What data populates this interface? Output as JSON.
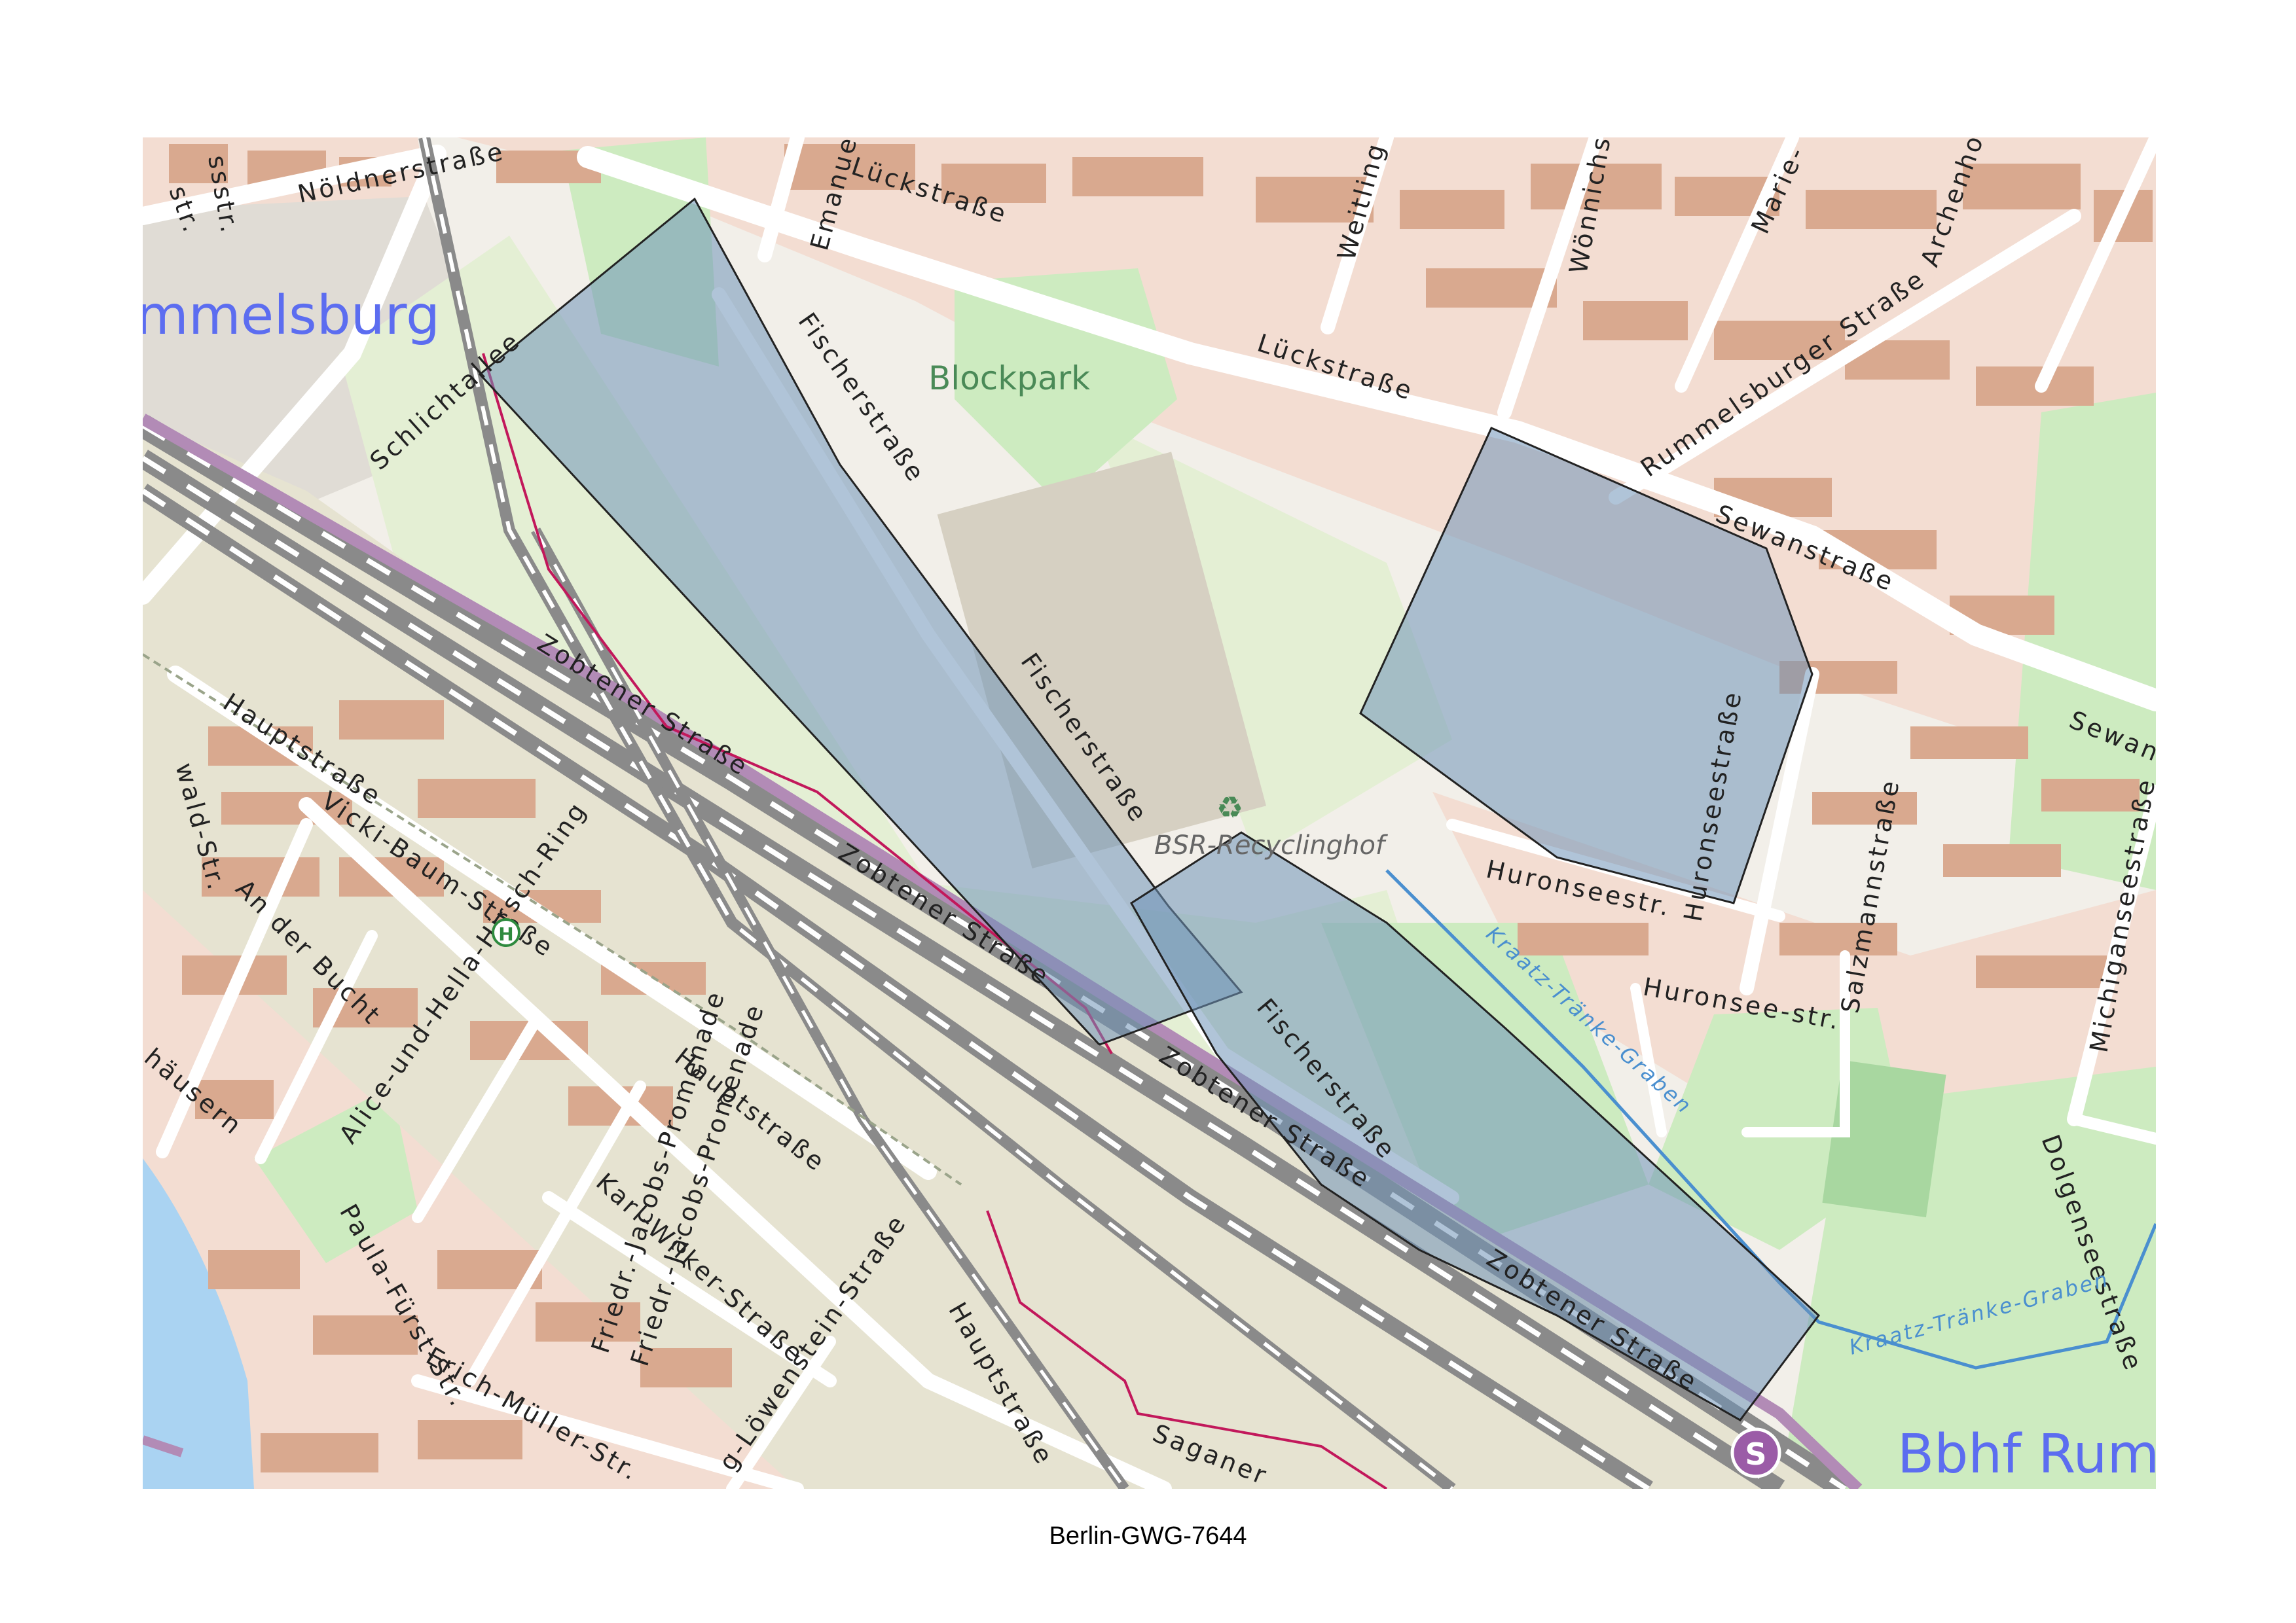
{
  "map": {
    "place_labels": [
      "mmelsburg",
      "Bbhf Rummelsb"
    ],
    "park_label": "Blockpark",
    "poi_label": "BSR-Recyclinghof",
    "water_labels": [
      "Kraatz-Tränke-Graben",
      "Kraatz-Tränke-Graben"
    ],
    "streets": [
      "Nöldnerstraße",
      "Lückstraße",
      "Lückstraße",
      "Emanuel",
      "Weitling",
      "Wönnichstr.",
      "Marie-",
      "Archenholdstr.",
      "Rummelsburger Straße",
      "Sewanstraße",
      "Sewan",
      "Schlichtallee",
      "Fischerstraße",
      "Fischerstraße",
      "Fischerstraße",
      "Zobtener Straße",
      "Zobtener Straße",
      "Zobtener Straße",
      "Zobtener Straße",
      "Hauptstraße",
      "Hauptstraße",
      "Hauptstraße",
      "Vicki-Baum-Straße",
      "An der Bucht",
      "Alice-und-Hella-Hirsch-Ring",
      "Paula-Fürst-Str.",
      "Karl-Wilker-Straße",
      "Erich-Müller-Str.",
      "g-Löwenstein-Straße",
      "Friedr.-Jacobs-Promenade",
      "Friedr.-Jacobs-Promenade",
      "Huronseestraße",
      "Huronseestr.",
      "Huronsee-str.",
      "Salzmannstraße",
      "Michiganseestraße",
      "Dolgenseestraße",
      "Saganer",
      "ssstr.",
      "wald-Str.",
      "häusern",
      "str."
    ],
    "transit_symbols": {
      "bus": "H",
      "sbahn": "S"
    },
    "recycle_symbol": "♻",
    "colors": {
      "land": "#f2efe9",
      "building": "#d9a98f",
      "residential": "#f3ddd2",
      "park": "#cdebc0",
      "grass": "#e4efd4",
      "railway_area": "#e6e3d1",
      "rail_line": "#8a8a8a",
      "sbahn_line": "#b28bb6",
      "water": "#aad3f2",
      "highlight_fill": "#6f93b8",
      "highlight_stroke": "#222222",
      "boundary": "#c2185b"
    }
  },
  "caption": "Berlin-GWG-7644"
}
